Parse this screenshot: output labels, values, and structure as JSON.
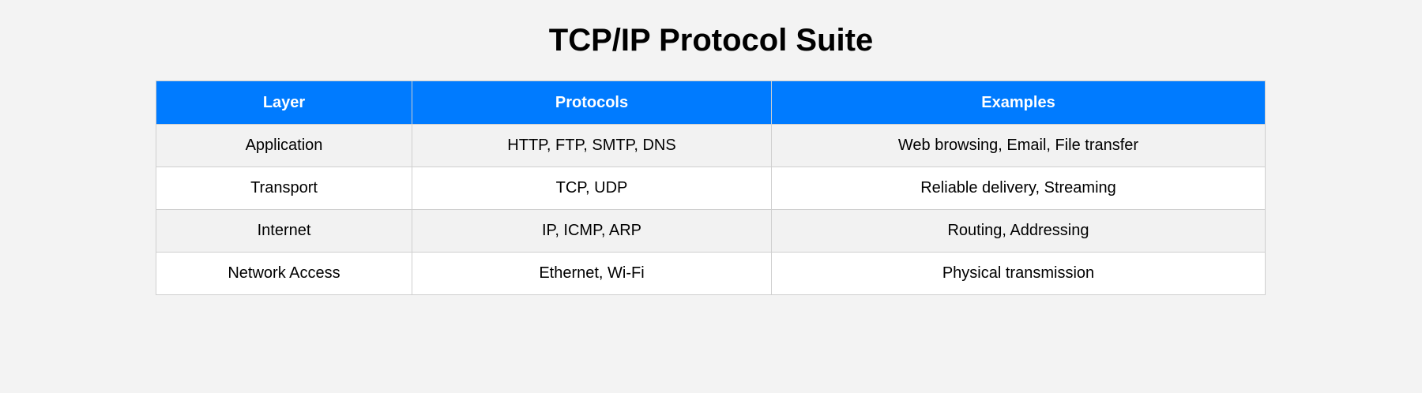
{
  "page": {
    "title": "TCP/IP Protocol Suite"
  },
  "table": {
    "headers": [
      "Layer",
      "Protocols",
      "Examples"
    ],
    "rows": [
      [
        "Application",
        "HTTP, FTP, SMTP, DNS",
        "Web browsing, Email, File transfer"
      ],
      [
        "Transport",
        "TCP, UDP",
        "Reliable delivery, Streaming"
      ],
      [
        "Internet",
        "IP, ICMP, ARP",
        "Routing, Addressing"
      ],
      [
        "Network Access",
        "Ethernet, Wi-Fi",
        "Physical transmission"
      ]
    ]
  },
  "colors": {
    "header_bg": "#007bff",
    "header_text": "#ffffff",
    "row_alt_bg": "#f2f2f2",
    "row_bg": "#ffffff",
    "page_bg": "#f3f3f3"
  }
}
